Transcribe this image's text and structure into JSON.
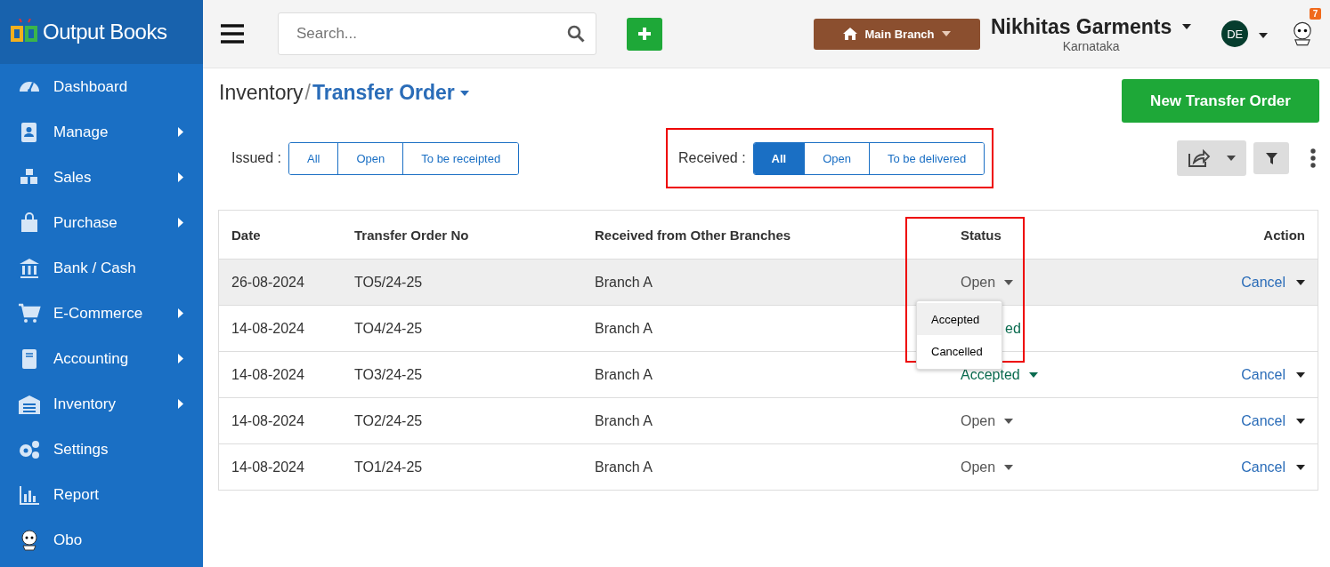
{
  "sidebar": {
    "brand": "Output Books",
    "items": [
      {
        "label": "Dashboard",
        "expandable": false
      },
      {
        "label": "Manage",
        "expandable": true
      },
      {
        "label": "Sales",
        "expandable": true
      },
      {
        "label": "Purchase",
        "expandable": true
      },
      {
        "label": "Bank / Cash",
        "expandable": false
      },
      {
        "label": "E-Commerce",
        "expandable": true
      },
      {
        "label": "Accounting",
        "expandable": true
      },
      {
        "label": "Inventory",
        "expandable": true
      },
      {
        "label": "Settings",
        "expandable": false
      },
      {
        "label": "Report",
        "expandable": false
      },
      {
        "label": "Obo",
        "expandable": false
      }
    ]
  },
  "topbar": {
    "search": {
      "placeholder": "Search..."
    },
    "branch": "Main Branch",
    "company": "Nikhitas Garments",
    "state": "Karnataka",
    "avatar": "DE",
    "notifications": "7"
  },
  "breadcrumb": {
    "parent": "Inventory",
    "separator": "/",
    "current": "Transfer Order"
  },
  "new_button": "New Transfer Order",
  "filters": [
    {
      "label": "Issued :",
      "highlighted": false,
      "options": [
        {
          "label": "All",
          "selected": false
        },
        {
          "label": "Open",
          "selected": false
        },
        {
          "label": "To be receipted",
          "selected": false
        }
      ]
    },
    {
      "label": "Received :",
      "highlighted": true,
      "options": [
        {
          "label": "All",
          "selected": true
        },
        {
          "label": "Open",
          "selected": false
        },
        {
          "label": "To be delivered",
          "selected": false
        }
      ]
    }
  ],
  "table": {
    "columns": [
      "Date",
      "Transfer Order No",
      "Received from Other Branches",
      "Status",
      "Action"
    ],
    "status_highlighted": true,
    "rows": [
      {
        "date": "26-08-2024",
        "number": "TO5/24-25",
        "branch": "Branch A",
        "status": "Open",
        "kind": "open",
        "status_covered": false,
        "action": "Cancel",
        "hovered": true
      },
      {
        "date": "14-08-2024",
        "number": "TO4/24-25",
        "branch": "Branch A",
        "status": "ed",
        "kind": "accepted",
        "status_covered": true,
        "hovered": false
      },
      {
        "date": "14-08-2024",
        "number": "TO3/24-25",
        "branch": "Branch A",
        "status": "Accepted",
        "kind": "accepted",
        "status_covered": false,
        "action": "Cancel",
        "hovered": false
      },
      {
        "date": "14-08-2024",
        "number": "TO2/24-25",
        "branch": "Branch A",
        "status": "Open",
        "kind": "open",
        "status_covered": false,
        "action": "Cancel",
        "hovered": false
      },
      {
        "date": "14-08-2024",
        "number": "TO1/24-25",
        "branch": "Branch A",
        "status": "Open",
        "kind": "open",
        "status_covered": false,
        "action": "Cancel",
        "hovered": false
      }
    ]
  },
  "status_menu": {
    "items": [
      {
        "label": "Accepted",
        "selected": true
      },
      {
        "label": "Cancelled",
        "selected": false
      }
    ]
  }
}
